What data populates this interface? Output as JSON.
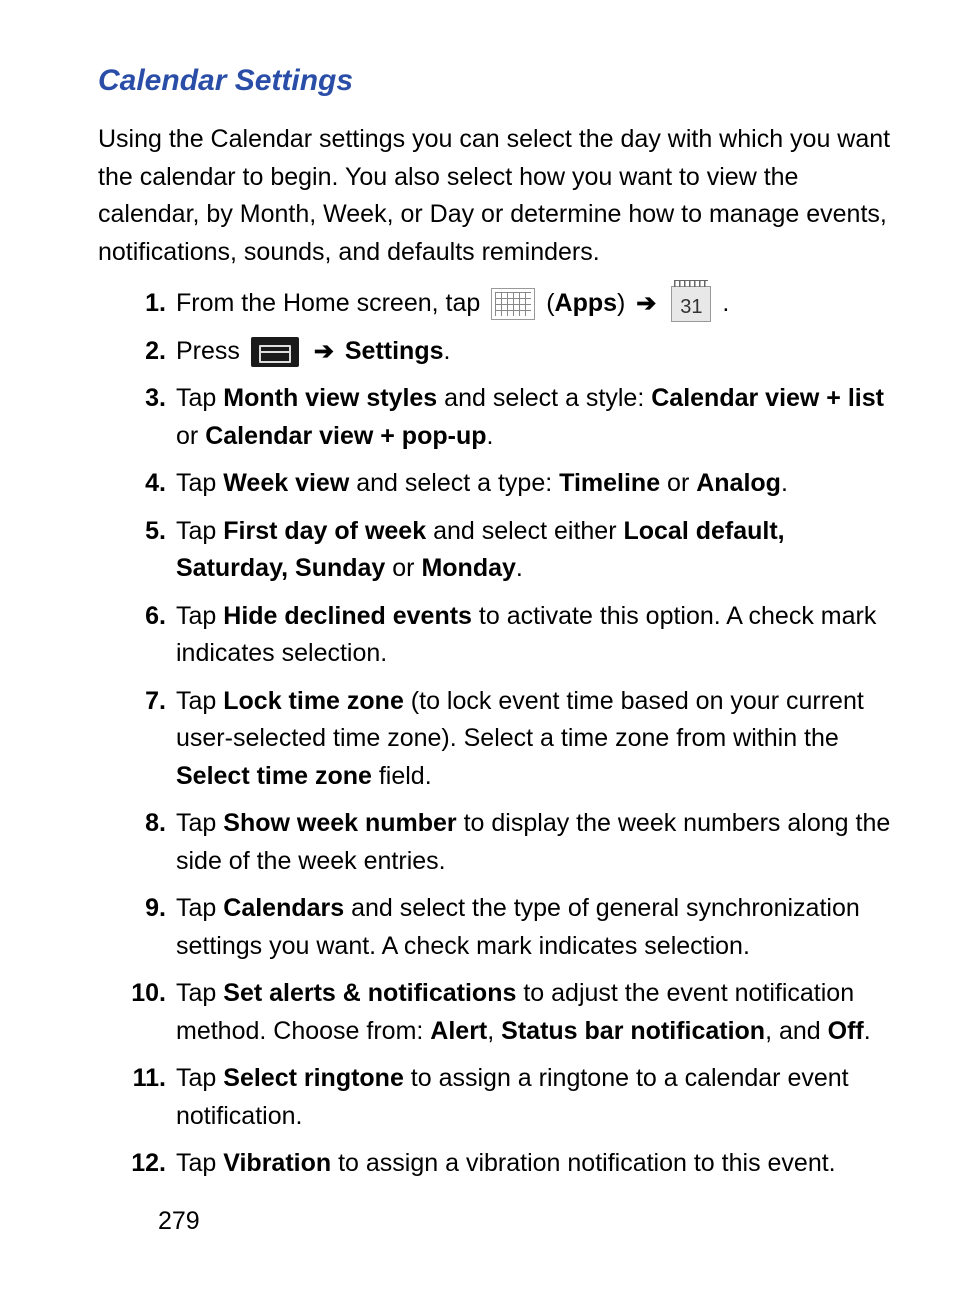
{
  "title": "Calendar Settings",
  "intro": "Using the Calendar settings you can select the day with which you want the calendar to begin. You also select how you want to view the calendar, by Month, Week, or Day or determine how to manage events, notifications, sounds, and defaults reminders.",
  "steps": {
    "n1": "1.",
    "s1_a": "From the Home screen, tap ",
    "s1_apps": "Apps",
    "s1_cal_num": "31",
    "n2": "2.",
    "s2_a": "Press ",
    "s2_settings": "Settings",
    "n3": "3.",
    "s3_tap": "Tap ",
    "s3_b1": "Month view styles",
    "s3_mid": " and select a style: ",
    "s3_b2": "Calendar view + list",
    "s3_or": " or ",
    "s3_b3": "Calendar view + pop-up",
    "n4": "4.",
    "s4_tap": "Tap ",
    "s4_b1": "Week view",
    "s4_mid": " and select a type: ",
    "s4_b2": "Timeline",
    "s4_or": " or ",
    "s4_b3": "Analog",
    "n5": "5.",
    "s5_tap": "Tap ",
    "s5_b1": "First day of week",
    "s5_mid": " and select either ",
    "s5_b2": "Local default, Saturday, Sunday",
    "s5_or": " or ",
    "s5_b3": "Monday",
    "n6": "6.",
    "s6_tap": "Tap ",
    "s6_b1": "Hide declined events",
    "s6_rest": " to activate this option. A check mark indicates selection.",
    "n7": "7.",
    "s7_tap": "Tap ",
    "s7_b1": "Lock time zone",
    "s7_mid": " (to lock event time based on your current user-selected time zone). Select a time zone from within the ",
    "s7_b2": "Select time zone",
    "s7_rest": " field.",
    "n8": "8.",
    "s8_tap": "Tap ",
    "s8_b1": "Show week number",
    "s8_rest": " to display the week numbers along the side of the week entries.",
    "n9": "9.",
    "s9_tap": "Tap ",
    "s9_b1": "Calendars",
    "s9_rest": " and select the type of general synchronization settings you want. A check mark indicates selection.",
    "n10": "10.",
    "s10_tap": "Tap ",
    "s10_b1": "Set alerts & notifications",
    "s10_mid": " to adjust the event notification method. Choose from: ",
    "s10_b2": "Alert",
    "s10_c1": ", ",
    "s10_b3": "Status bar notification",
    "s10_c2": ", and ",
    "s10_b4": "Off",
    "n11": "11.",
    "s11_tap": "Tap ",
    "s11_b1": "Select ringtone",
    "s11_rest": " to assign a ringtone to a calendar event notification.",
    "n12": "12.",
    "s12_tap": "Tap ",
    "s12_b1": "Vibration",
    "s12_rest": " to assign a vibration notification to this event."
  },
  "page_number": "279"
}
